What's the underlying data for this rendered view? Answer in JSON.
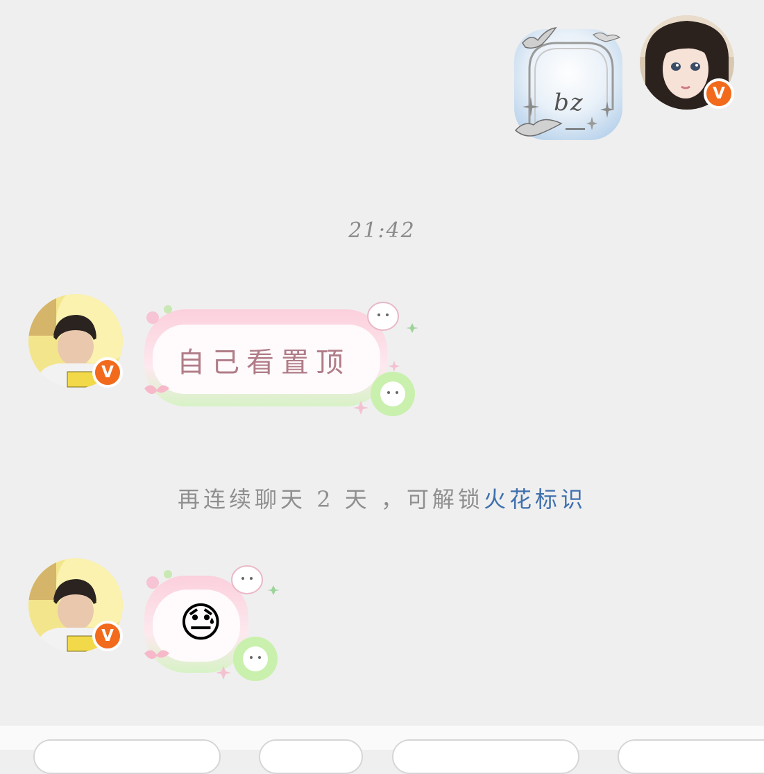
{
  "messages": {
    "my_sticker": {
      "text": "bz"
    },
    "timestamp": "21:42",
    "incoming_text": {
      "text": "自己看置顶"
    },
    "system_notice": {
      "prefix": "再连续聊天 2 天 ，可解锁",
      "link": "火花标识"
    },
    "incoming_emoji": {
      "emoji": "😓"
    }
  },
  "avatars": {
    "badge_label": "V",
    "badge_color": "#f26a1b"
  },
  "colors": {
    "background": "#efefef",
    "link": "#3e6fae",
    "bubble_text": "#b07c88",
    "notice_text": "#8f8f8f"
  }
}
